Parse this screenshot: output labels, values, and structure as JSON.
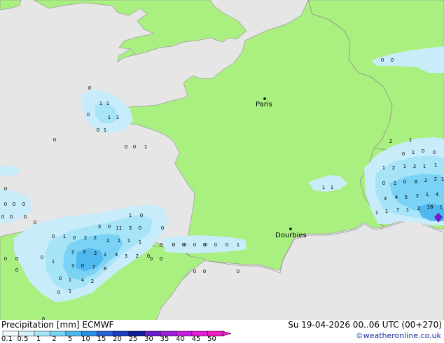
{
  "map": {
    "cities": [
      {
        "name": "Paris"
      },
      {
        "name": "Dourbies"
      }
    ],
    "precip_cells": [
      {
        "v": "0"
      },
      {
        "v": "1"
      },
      {
        "v": "1"
      },
      {
        "v": "0"
      },
      {
        "v": "1"
      },
      {
        "v": "1"
      },
      {
        "v": "0"
      },
      {
        "v": "1"
      },
      {
        "v": "0"
      },
      {
        "v": "0"
      },
      {
        "v": "0"
      },
      {
        "v": "1"
      },
      {
        "v": "0"
      },
      {
        "v": "0"
      },
      {
        "v": "0"
      },
      {
        "v": "0"
      },
      {
        "v": "0"
      },
      {
        "v": "0"
      },
      {
        "v": "0"
      },
      {
        "v": "0"
      },
      {
        "v": "0"
      },
      {
        "v": "0"
      },
      {
        "v": "0"
      },
      {
        "v": "0"
      },
      {
        "v": "0"
      },
      {
        "v": "0"
      },
      {
        "v": "0"
      },
      {
        "v": "0"
      },
      {
        "v": "0"
      },
      {
        "v": "1"
      },
      {
        "v": "0"
      },
      {
        "v": "3"
      },
      {
        "v": "0"
      },
      {
        "v": "11"
      },
      {
        "v": "3"
      },
      {
        "v": "0"
      },
      {
        "v": "0"
      },
      {
        "v": "0"
      },
      {
        "v": "1"
      },
      {
        "v": "0"
      },
      {
        "v": "2"
      },
      {
        "v": "2"
      },
      {
        "v": "2"
      },
      {
        "v": "1"
      },
      {
        "v": "1"
      },
      {
        "v": "1"
      },
      {
        "v": "2"
      },
      {
        "v": "3"
      },
      {
        "v": "3"
      },
      {
        "v": "2"
      },
      {
        "v": "3"
      },
      {
        "v": "3"
      },
      {
        "v": "2"
      },
      {
        "v": "0"
      },
      {
        "v": "1"
      },
      {
        "v": "3"
      },
      {
        "v": "0"
      },
      {
        "v": "7"
      },
      {
        "v": "8"
      },
      {
        "v": "0"
      },
      {
        "v": "1"
      },
      {
        "v": "4"
      },
      {
        "v": "2"
      },
      {
        "v": "1"
      },
      {
        "v": "0"
      },
      {
        "v": "0"
      },
      {
        "v": "0"
      },
      {
        "v": "0"
      },
      {
        "v": "0"
      },
      {
        "v": "1"
      },
      {
        "v": "0"
      },
      {
        "v": "0"
      },
      {
        "v": "0"
      },
      {
        "v": "0"
      },
      {
        "v": "0"
      },
      {
        "v": "0"
      },
      {
        "v": "0"
      },
      {
        "v": "1"
      },
      {
        "v": "1"
      },
      {
        "v": "2"
      },
      {
        "v": "1"
      },
      {
        "v": "0"
      },
      {
        "v": "1"
      },
      {
        "v": "0"
      },
      {
        "v": "0"
      },
      {
        "v": "1"
      },
      {
        "v": "2"
      },
      {
        "v": "1"
      },
      {
        "v": "2"
      },
      {
        "v": "1"
      },
      {
        "v": "1"
      },
      {
        "v": "0"
      },
      {
        "v": "1"
      },
      {
        "v": "0"
      },
      {
        "v": "8"
      },
      {
        "v": "2"
      },
      {
        "v": "2"
      },
      {
        "v": "1"
      },
      {
        "v": "3"
      },
      {
        "v": "4"
      },
      {
        "v": "5"
      },
      {
        "v": "2"
      },
      {
        "v": "1"
      },
      {
        "v": "4"
      },
      {
        "v": "1"
      },
      {
        "v": "1"
      },
      {
        "v": "7"
      },
      {
        "v": "1"
      },
      {
        "v": "2"
      },
      {
        "v": "18"
      },
      {
        "v": "1"
      },
      {
        "v": "0"
      },
      {
        "v": "0"
      }
    ]
  },
  "legend": {
    "title": "Precipitation [mm]  ECMWF",
    "date": "Su 19-04-2026 00..06 UTC (00+270)",
    "credit": "©weatheronline.co.uk",
    "ticks": [
      "0.1",
      "0.5",
      "1",
      "2",
      "5",
      "10",
      "15",
      "20",
      "25",
      "30",
      "35",
      "40",
      "45",
      "50"
    ],
    "colors": [
      "#f2fbff",
      "#d0f0fb",
      "#a8e4f8",
      "#7ad2f5",
      "#4fb8ee",
      "#2f8fe3",
      "#2a62d5",
      "#1f3fbf",
      "#11209a",
      "#6a1fc8",
      "#9c1fd8",
      "#c51fe0",
      "#e21fd8",
      "#f01fc0"
    ]
  }
}
